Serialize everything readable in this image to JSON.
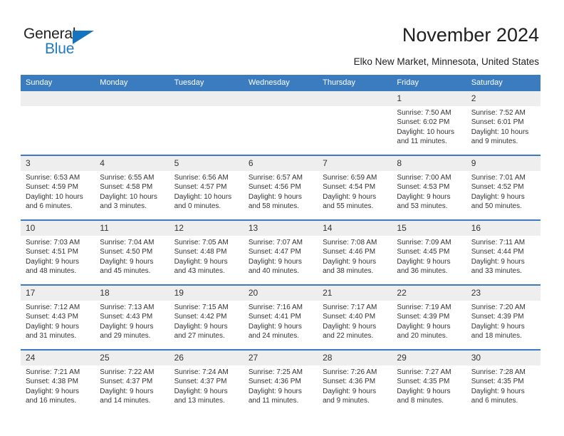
{
  "brand": {
    "name_primary": "General",
    "name_secondary": "Blue",
    "primary_color": "#231f20",
    "secondary_color": "#1f7ac4",
    "triangle_color": "#1673be"
  },
  "header": {
    "title": "November 2024",
    "subtitle": "Elko New Market, Minnesota, United States"
  },
  "theme": {
    "header_bar_color": "#3b7cc0",
    "daynum_band_color": "#eeeeee",
    "text_color": "#333333"
  },
  "calendar": {
    "weekday_headers": [
      "Sunday",
      "Monday",
      "Tuesday",
      "Wednesday",
      "Thursday",
      "Friday",
      "Saturday"
    ],
    "weeks": [
      [
        {
          "day": "",
          "lines": []
        },
        {
          "day": "",
          "lines": []
        },
        {
          "day": "",
          "lines": []
        },
        {
          "day": "",
          "lines": []
        },
        {
          "day": "",
          "lines": []
        },
        {
          "day": "1",
          "lines": [
            "Sunrise: 7:50 AM",
            "Sunset: 6:02 PM",
            "Daylight: 10 hours",
            "and 11 minutes."
          ]
        },
        {
          "day": "2",
          "lines": [
            "Sunrise: 7:52 AM",
            "Sunset: 6:01 PM",
            "Daylight: 10 hours",
            "and 9 minutes."
          ]
        }
      ],
      [
        {
          "day": "3",
          "lines": [
            "Sunrise: 6:53 AM",
            "Sunset: 4:59 PM",
            "Daylight: 10 hours",
            "and 6 minutes."
          ]
        },
        {
          "day": "4",
          "lines": [
            "Sunrise: 6:55 AM",
            "Sunset: 4:58 PM",
            "Daylight: 10 hours",
            "and 3 minutes."
          ]
        },
        {
          "day": "5",
          "lines": [
            "Sunrise: 6:56 AM",
            "Sunset: 4:57 PM",
            "Daylight: 10 hours",
            "and 0 minutes."
          ]
        },
        {
          "day": "6",
          "lines": [
            "Sunrise: 6:57 AM",
            "Sunset: 4:56 PM",
            "Daylight: 9 hours",
            "and 58 minutes."
          ]
        },
        {
          "day": "7",
          "lines": [
            "Sunrise: 6:59 AM",
            "Sunset: 4:54 PM",
            "Daylight: 9 hours",
            "and 55 minutes."
          ]
        },
        {
          "day": "8",
          "lines": [
            "Sunrise: 7:00 AM",
            "Sunset: 4:53 PM",
            "Daylight: 9 hours",
            "and 53 minutes."
          ]
        },
        {
          "day": "9",
          "lines": [
            "Sunrise: 7:01 AM",
            "Sunset: 4:52 PM",
            "Daylight: 9 hours",
            "and 50 minutes."
          ]
        }
      ],
      [
        {
          "day": "10",
          "lines": [
            "Sunrise: 7:03 AM",
            "Sunset: 4:51 PM",
            "Daylight: 9 hours",
            "and 48 minutes."
          ]
        },
        {
          "day": "11",
          "lines": [
            "Sunrise: 7:04 AM",
            "Sunset: 4:50 PM",
            "Daylight: 9 hours",
            "and 45 minutes."
          ]
        },
        {
          "day": "12",
          "lines": [
            "Sunrise: 7:05 AM",
            "Sunset: 4:48 PM",
            "Daylight: 9 hours",
            "and 43 minutes."
          ]
        },
        {
          "day": "13",
          "lines": [
            "Sunrise: 7:07 AM",
            "Sunset: 4:47 PM",
            "Daylight: 9 hours",
            "and 40 minutes."
          ]
        },
        {
          "day": "14",
          "lines": [
            "Sunrise: 7:08 AM",
            "Sunset: 4:46 PM",
            "Daylight: 9 hours",
            "and 38 minutes."
          ]
        },
        {
          "day": "15",
          "lines": [
            "Sunrise: 7:09 AM",
            "Sunset: 4:45 PM",
            "Daylight: 9 hours",
            "and 36 minutes."
          ]
        },
        {
          "day": "16",
          "lines": [
            "Sunrise: 7:11 AM",
            "Sunset: 4:44 PM",
            "Daylight: 9 hours",
            "and 33 minutes."
          ]
        }
      ],
      [
        {
          "day": "17",
          "lines": [
            "Sunrise: 7:12 AM",
            "Sunset: 4:43 PM",
            "Daylight: 9 hours",
            "and 31 minutes."
          ]
        },
        {
          "day": "18",
          "lines": [
            "Sunrise: 7:13 AM",
            "Sunset: 4:43 PM",
            "Daylight: 9 hours",
            "and 29 minutes."
          ]
        },
        {
          "day": "19",
          "lines": [
            "Sunrise: 7:15 AM",
            "Sunset: 4:42 PM",
            "Daylight: 9 hours",
            "and 27 minutes."
          ]
        },
        {
          "day": "20",
          "lines": [
            "Sunrise: 7:16 AM",
            "Sunset: 4:41 PM",
            "Daylight: 9 hours",
            "and 24 minutes."
          ]
        },
        {
          "day": "21",
          "lines": [
            "Sunrise: 7:17 AM",
            "Sunset: 4:40 PM",
            "Daylight: 9 hours",
            "and 22 minutes."
          ]
        },
        {
          "day": "22",
          "lines": [
            "Sunrise: 7:19 AM",
            "Sunset: 4:39 PM",
            "Daylight: 9 hours",
            "and 20 minutes."
          ]
        },
        {
          "day": "23",
          "lines": [
            "Sunrise: 7:20 AM",
            "Sunset: 4:39 PM",
            "Daylight: 9 hours",
            "and 18 minutes."
          ]
        }
      ],
      [
        {
          "day": "24",
          "lines": [
            "Sunrise: 7:21 AM",
            "Sunset: 4:38 PM",
            "Daylight: 9 hours",
            "and 16 minutes."
          ]
        },
        {
          "day": "25",
          "lines": [
            "Sunrise: 7:22 AM",
            "Sunset: 4:37 PM",
            "Daylight: 9 hours",
            "and 14 minutes."
          ]
        },
        {
          "day": "26",
          "lines": [
            "Sunrise: 7:24 AM",
            "Sunset: 4:37 PM",
            "Daylight: 9 hours",
            "and 13 minutes."
          ]
        },
        {
          "day": "27",
          "lines": [
            "Sunrise: 7:25 AM",
            "Sunset: 4:36 PM",
            "Daylight: 9 hours",
            "and 11 minutes."
          ]
        },
        {
          "day": "28",
          "lines": [
            "Sunrise: 7:26 AM",
            "Sunset: 4:36 PM",
            "Daylight: 9 hours",
            "and 9 minutes."
          ]
        },
        {
          "day": "29",
          "lines": [
            "Sunrise: 7:27 AM",
            "Sunset: 4:35 PM",
            "Daylight: 9 hours",
            "and 8 minutes."
          ]
        },
        {
          "day": "30",
          "lines": [
            "Sunrise: 7:28 AM",
            "Sunset: 4:35 PM",
            "Daylight: 9 hours",
            "and 6 minutes."
          ]
        }
      ]
    ]
  }
}
